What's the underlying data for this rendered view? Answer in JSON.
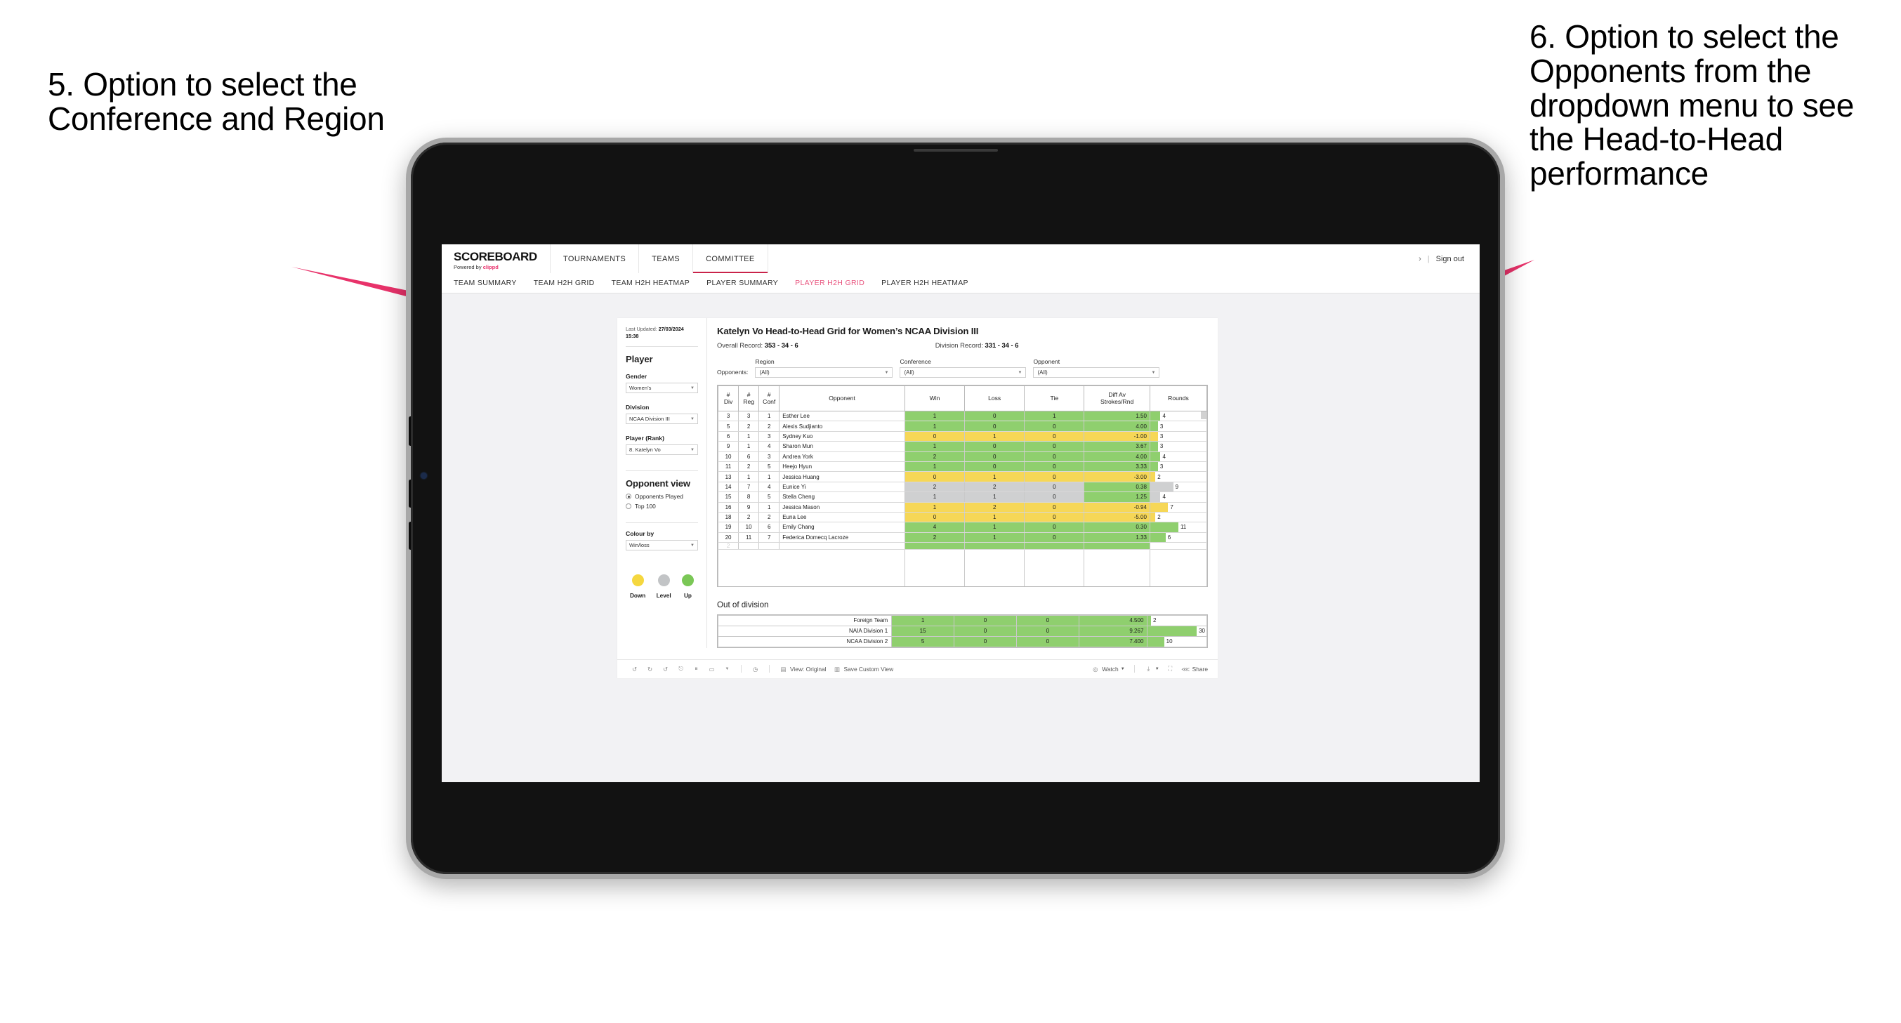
{
  "annotations": {
    "left": "5. Option to select the Conference and Region",
    "right": "6. Option to select the Opponents from the dropdown menu to see the Head-to-Head performance",
    "accent_color": "#e8326a"
  },
  "topnav": {
    "logo_word": "SCOREBOARD",
    "logo_powered_prefix": "Powered by ",
    "logo_powered_brand": "clippd",
    "items": [
      {
        "label": "TOURNAMENTS",
        "active": false
      },
      {
        "label": "TEAMS",
        "active": false
      },
      {
        "label": "COMMITTEE",
        "active": true
      }
    ],
    "chevron": "›",
    "separator": "|",
    "sign_out": "Sign out"
  },
  "subnav": {
    "items": [
      {
        "label": "TEAM SUMMARY",
        "active": false
      },
      {
        "label": "TEAM H2H GRID",
        "active": false
      },
      {
        "label": "TEAM H2H HEATMAP",
        "active": false
      },
      {
        "label": "PLAYER SUMMARY",
        "active": false
      },
      {
        "label": "PLAYER H2H GRID",
        "active": true
      },
      {
        "label": "PLAYER H2H HEATMAP",
        "active": false
      }
    ],
    "active_color": "#e8557f"
  },
  "sidebar": {
    "last_updated_label": "Last Updated: ",
    "last_updated_value": "27/03/2024",
    "last_updated_time": "15:38",
    "heading": "Player",
    "gender": {
      "label": "Gender",
      "value": "Women’s"
    },
    "division": {
      "label": "Division",
      "value": "NCAA Division III"
    },
    "player_rank": {
      "label": "Player (Rank)",
      "value": "8. Katelyn Vo"
    },
    "opponent_view": {
      "heading": "Opponent view",
      "options": [
        {
          "label": "Opponents Played",
          "selected": true
        },
        {
          "label": "Top 100",
          "selected": false
        }
      ]
    },
    "colour_by": {
      "label": "Colour by",
      "value": "Win/loss"
    },
    "legend": [
      {
        "label": "Down",
        "color": "#f5d73f"
      },
      {
        "label": "Level",
        "color": "#c2c4c6"
      },
      {
        "label": "Up",
        "color": "#7ac756"
      }
    ]
  },
  "main": {
    "title": "Katelyn Vo Head-to-Head Grid for Women’s NCAA Division III",
    "overall_record_label": "Overall Record: ",
    "overall_record_value": "353 - 34 - 6",
    "division_record_label": "Division Record: ",
    "division_record_value": "331 - 34 - 6",
    "filters": {
      "opponents_label": "Opponents:",
      "region": {
        "caption": "Region",
        "value": "(All)"
      },
      "conference": {
        "caption": "Conference",
        "value": "(All)"
      },
      "opponent": {
        "caption": "Opponent",
        "value": "(All)"
      }
    }
  },
  "chart_data": {
    "type": "table",
    "title": "Katelyn Vo Head-to-Head Grid for Women’s NCAA Division III",
    "columns": [
      "# Div",
      "# Reg",
      "# Conf",
      "Opponent",
      "Win",
      "Loss",
      "Tie",
      "Diff Av Strokes/Rnd",
      "Rounds"
    ],
    "column_headers_multiline": [
      {
        "line1": "#",
        "line2": "Div"
      },
      {
        "line1": "#",
        "line2": "Reg"
      },
      {
        "line1": "#",
        "line2": "Conf"
      },
      {
        "line1": "Opponent",
        "line2": ""
      },
      {
        "line1": "Win",
        "line2": ""
      },
      {
        "line1": "Loss",
        "line2": ""
      },
      {
        "line1": "Tie",
        "line2": ""
      },
      {
        "line1": "Diff Av",
        "line2": "Strokes/Rnd"
      },
      {
        "line1": "Rounds",
        "line2": ""
      }
    ],
    "rounds_max": 22,
    "colors": {
      "up": "#8fcf6e",
      "down": "#f6d757",
      "level": "#cfd0d1"
    },
    "rows": [
      {
        "div": "3",
        "reg": "3",
        "conf": "1",
        "opponent": "Esther Lee",
        "win": "1",
        "loss": "0",
        "tie": "1",
        "diff": "1.50",
        "rounds": "4",
        "state": "up"
      },
      {
        "div": "5",
        "reg": "2",
        "conf": "2",
        "opponent": "Alexis Sudjianto",
        "win": "1",
        "loss": "0",
        "tie": "0",
        "diff": "4.00",
        "rounds": "3",
        "state": "up"
      },
      {
        "div": "6",
        "reg": "1",
        "conf": "3",
        "opponent": "Sydney Kuo",
        "win": "0",
        "loss": "1",
        "tie": "0",
        "diff": "-1.00",
        "rounds": "3",
        "state": "down"
      },
      {
        "div": "9",
        "reg": "1",
        "conf": "4",
        "opponent": "Sharon Mun",
        "win": "1",
        "loss": "0",
        "tie": "0",
        "diff": "3.67",
        "rounds": "3",
        "state": "up"
      },
      {
        "div": "10",
        "reg": "6",
        "conf": "3",
        "opponent": "Andrea York",
        "win": "2",
        "loss": "0",
        "tie": "0",
        "diff": "4.00",
        "rounds": "4",
        "state": "up"
      },
      {
        "div": "11",
        "reg": "2",
        "conf": "5",
        "opponent": "Heejo Hyun",
        "win": "1",
        "loss": "0",
        "tie": "0",
        "diff": "3.33",
        "rounds": "3",
        "state": "up"
      },
      {
        "div": "13",
        "reg": "1",
        "conf": "1",
        "opponent": "Jessica Huang",
        "win": "0",
        "loss": "1",
        "tie": "0",
        "diff": "-3.00",
        "rounds": "2",
        "state": "down"
      },
      {
        "div": "14",
        "reg": "7",
        "conf": "4",
        "opponent": "Eunice Yi",
        "win": "2",
        "loss": "2",
        "tie": "0",
        "diff": "0.38",
        "rounds": "9",
        "state": "level",
        "diff_state": "up"
      },
      {
        "div": "15",
        "reg": "8",
        "conf": "5",
        "opponent": "Stella Cheng",
        "win": "1",
        "loss": "1",
        "tie": "0",
        "diff": "1.25",
        "rounds": "4",
        "state": "level",
        "diff_state": "up"
      },
      {
        "div": "16",
        "reg": "9",
        "conf": "1",
        "opponent": "Jessica Mason",
        "win": "1",
        "loss": "2",
        "tie": "0",
        "diff": "-0.94",
        "rounds": "7",
        "state": "down"
      },
      {
        "div": "18",
        "reg": "2",
        "conf": "2",
        "opponent": "Euna Lee",
        "win": "0",
        "loss": "1",
        "tie": "0",
        "diff": "-5.00",
        "rounds": "2",
        "state": "down"
      },
      {
        "div": "19",
        "reg": "10",
        "conf": "6",
        "opponent": "Emily Chang",
        "win": "4",
        "loss": "1",
        "tie": "0",
        "diff": "0.30",
        "rounds": "11",
        "state": "up"
      },
      {
        "div": "20",
        "reg": "11",
        "conf": "7",
        "opponent": "Federica Domecq Lacroze",
        "win": "2",
        "loss": "1",
        "tie": "0",
        "diff": "1.33",
        "rounds": "6",
        "state": "up"
      }
    ],
    "out_of_division": {
      "title": "Out of division",
      "rows": [
        {
          "name": "Foreign Team",
          "win": "1",
          "loss": "0",
          "tie": "0",
          "diff": "4.500",
          "rounds": "2",
          "state": "up"
        },
        {
          "name": "NAIA Division 1",
          "win": "15",
          "loss": "0",
          "tie": "0",
          "diff": "9.267",
          "rounds": "30",
          "state": "up"
        },
        {
          "name": "NCAA Division 2",
          "win": "5",
          "loss": "0",
          "tie": "0",
          "diff": "7.400",
          "rounds": "10",
          "state": "up"
        }
      ],
      "rounds_max": 36
    }
  },
  "toolbar": {
    "view_label": "View: Original",
    "save_label": "Save Custom View",
    "watch_label": "Watch",
    "share_label": "Share"
  }
}
